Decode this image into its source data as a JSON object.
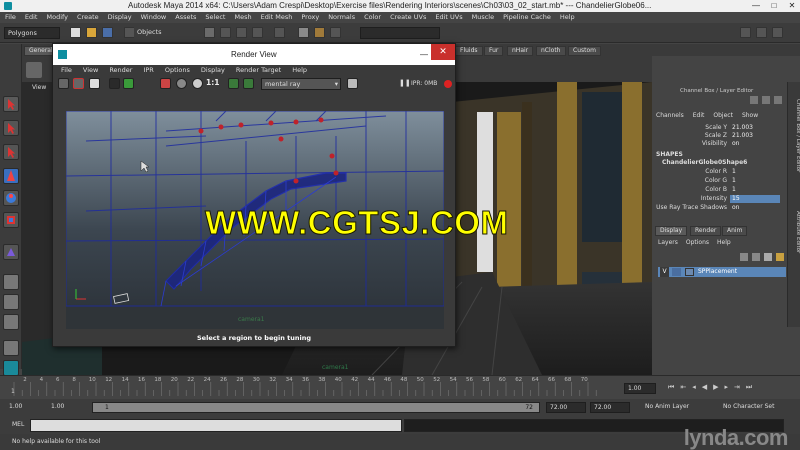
{
  "window": {
    "title": "Autodesk Maya 2014 x64: C:\\Users\\Adam Crespi\\Desktop\\Exercise files\\Rendering Interiors\\scenes\\Ch03\\03_02_start.mb*   ---   ChandelierGlobe06...",
    "controls": [
      "—",
      "□",
      "✕"
    ]
  },
  "main_menu": [
    "File",
    "Edit",
    "Modify",
    "Create",
    "Display",
    "Window",
    "Assets",
    "Select",
    "Mesh",
    "Edit Mesh",
    "Proxy",
    "Normals",
    "Color",
    "Create UVs",
    "Edit UVs",
    "Muscle",
    "Pipeline Cache",
    "Help"
  ],
  "status_line": {
    "menuset": "Polygons",
    "objects_label": "Objects"
  },
  "shelf": {
    "tabs": [
      "General",
      "Fluids",
      "Fur",
      "nHair",
      "nCloth",
      "Custom"
    ]
  },
  "viewport": {
    "menu": "View",
    "camera_label": "camera1"
  },
  "watermark": "WWW.CGTSJ.COM",
  "render_view": {
    "title": "Render View",
    "menu": [
      "File",
      "View",
      "Render",
      "IPR",
      "Options",
      "Display",
      "Render Target",
      "Help"
    ],
    "zoom": "1:1",
    "renderer": "mental ray",
    "ipr_status": "IPR: 0MB",
    "camera_label": "camera1",
    "status": "Select a region to begin tuning"
  },
  "channel_box": {
    "header": "Channel Box / Layer Editor",
    "menu": [
      "Channels",
      "Edit",
      "Object",
      "Show"
    ],
    "rows": [
      {
        "k": "Scale Y",
        "v": "21.003"
      },
      {
        "k": "Scale Z",
        "v": "21.003"
      },
      {
        "k": "Visibility",
        "v": "on"
      }
    ],
    "shapes_label": "SHAPES",
    "shape_name": "ChandelierGlobe0Shape6",
    "shape_rows": [
      {
        "k": "Color R",
        "v": "1"
      },
      {
        "k": "Color G",
        "v": "1"
      },
      {
        "k": "Color B",
        "v": "1"
      },
      {
        "k": "Intensity",
        "v": "15"
      },
      {
        "k": "Use Ray Trace Shadows",
        "v": "on"
      }
    ]
  },
  "side_tabs": [
    "Channel Box / Layer Editor",
    "Attribute Editor"
  ],
  "layer_editor": {
    "tabs": [
      "Display",
      "Render",
      "Anim"
    ],
    "menu": [
      "Layers",
      "Options",
      "Help"
    ],
    "layer": {
      "visible": "V",
      "name": "SPPlacement"
    }
  },
  "timeline": {
    "ticks": [
      "2",
      "4",
      "6",
      "8",
      "10",
      "12",
      "14",
      "16",
      "18",
      "20",
      "22",
      "24",
      "26",
      "28",
      "30",
      "32",
      "34",
      "36",
      "38",
      "40",
      "42",
      "44",
      "46",
      "48",
      "50",
      "52",
      "54",
      "56",
      "58",
      "60",
      "62",
      "64",
      "66",
      "68",
      "70"
    ],
    "first_tick": "1",
    "current_frame": "1.00"
  },
  "range": {
    "start": "1.00",
    "start2": "1.00",
    "slider_start": "1",
    "slider_end": "72",
    "end": "72.00",
    "end2": "72.00",
    "anim_layer": "No Anim Layer",
    "character": "No Character Set"
  },
  "command_line": {
    "label": "MEL"
  },
  "help_line": "No help available for this tool",
  "brand": "lynda.com"
}
